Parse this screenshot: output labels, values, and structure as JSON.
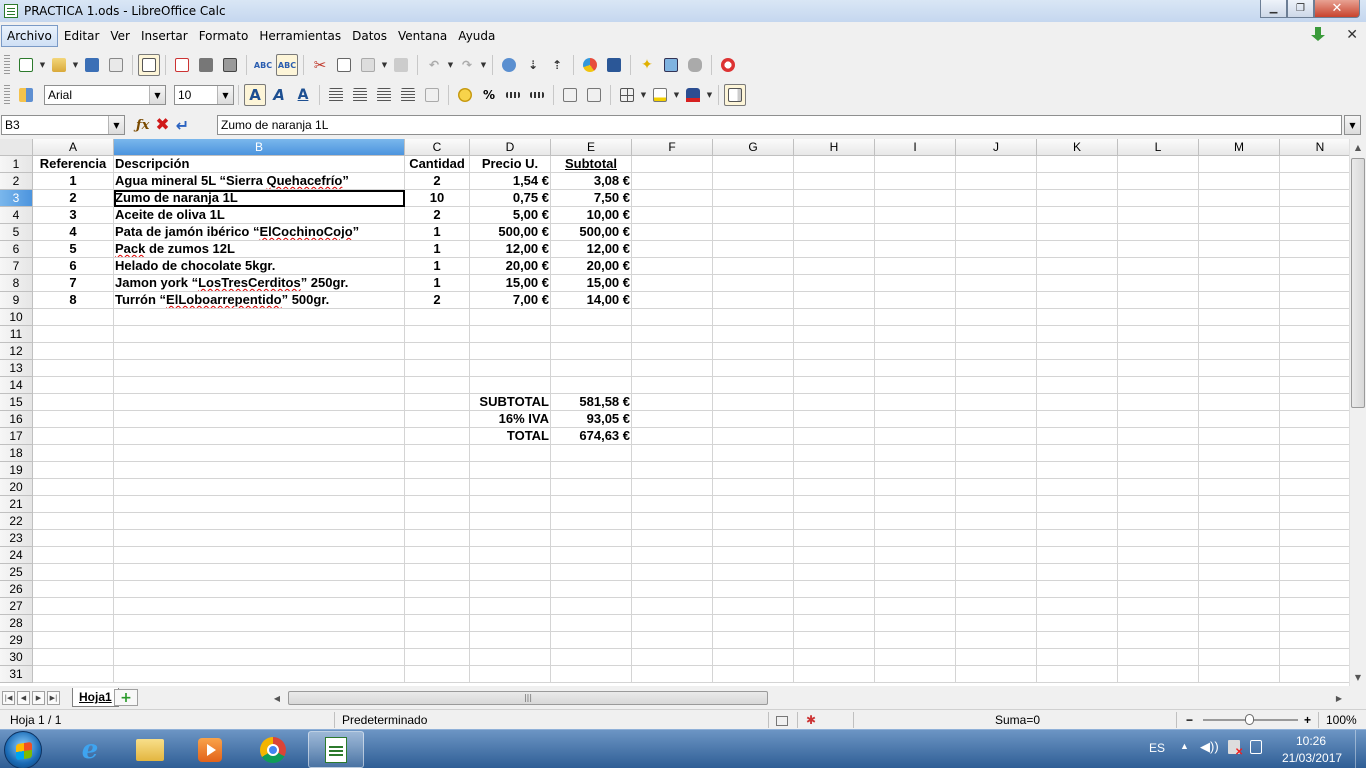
{
  "window": {
    "title": "PRACTICA 1.ods - LibreOffice Calc"
  },
  "menu": [
    "Archivo",
    "Editar",
    "Ver",
    "Insertar",
    "Formato",
    "Herramientas",
    "Datos",
    "Ventana",
    "Ayuda"
  ],
  "format_toolbar": {
    "font_name": "Arial",
    "font_size": "10",
    "percent_glyph": "%"
  },
  "formula_bar": {
    "cell_ref": "B3",
    "content": "Zumo de naranja 1L"
  },
  "columns": [
    "A",
    "B",
    "C",
    "D",
    "E",
    "F",
    "G",
    "H",
    "I",
    "J",
    "K",
    "L",
    "M",
    "N"
  ],
  "rows": [
    "1",
    "2",
    "3",
    "4",
    "5",
    "6",
    "7",
    "8",
    "9",
    "10",
    "11",
    "12",
    "13",
    "14",
    "15",
    "16",
    "17",
    "18",
    "19",
    "20",
    "21",
    "22",
    "23",
    "24",
    "25",
    "26",
    "27",
    "28",
    "29",
    "30",
    "31"
  ],
  "sheet": {
    "header": {
      "referencia": "Referencia",
      "descripcion": "Descripción",
      "cantidad": "Cantidad",
      "precio": "Precio U.",
      "subtotal": "Subtotal"
    },
    "items": [
      {
        "ref": "1",
        "desc": [
          "Agua mineral 5L “Sierra ",
          "Quehacefrío",
          "”"
        ],
        "qty": "2",
        "price": "1,54 €",
        "subtotal": "3,08 €"
      },
      {
        "ref": "2",
        "desc": [
          "Zumo de naranja 1L",
          "",
          ""
        ],
        "qty": "10",
        "price": "0,75 €",
        "subtotal": "7,50 €"
      },
      {
        "ref": "3",
        "desc": [
          "Aceite de oliva 1L",
          "",
          ""
        ],
        "qty": "2",
        "price": "5,00 €",
        "subtotal": "10,00 €"
      },
      {
        "ref": "4",
        "desc": [
          "Pata de jamón ibérico “",
          "ElCochinoCojo",
          "”"
        ],
        "qty": "1",
        "price": "500,00 €",
        "subtotal": "500,00 €"
      },
      {
        "ref": "5",
        "desc": [
          "",
          "Pack",
          " de zumos 12L"
        ],
        "qty": "1",
        "price": "12,00 €",
        "subtotal": "12,00 €"
      },
      {
        "ref": "6",
        "desc": [
          "Helado de chocolate 5kgr.",
          "",
          ""
        ],
        "qty": "1",
        "price": "20,00 €",
        "subtotal": "20,00 €"
      },
      {
        "ref": "7",
        "desc": [
          "Jamon york “",
          "LosTresCerditos",
          "” 250gr."
        ],
        "qty": "1",
        "price": "15,00 €",
        "subtotal": "15,00 €"
      },
      {
        "ref": "8",
        "desc": [
          "Turrón “",
          "ElLoboarrepentido",
          "” 500gr."
        ],
        "qty": "2",
        "price": "7,00 €",
        "subtotal": "14,00 €"
      }
    ],
    "totals": [
      {
        "label": "SUBTOTAL",
        "value": "581,58 €"
      },
      {
        "label": "16% IVA",
        "value": "93,05 €"
      },
      {
        "label": "TOTAL",
        "value": "674,63 €"
      }
    ]
  },
  "sheet_tabs": {
    "active": "Hoja1"
  },
  "status_bar": {
    "sheet_position": "Hoja 1 / 1",
    "page_style": "Predeterminado",
    "sum": "Suma=0",
    "zoom": "100%"
  },
  "taskbar": {
    "language": "ES",
    "time": "10:26",
    "date": "21/03/2017"
  }
}
